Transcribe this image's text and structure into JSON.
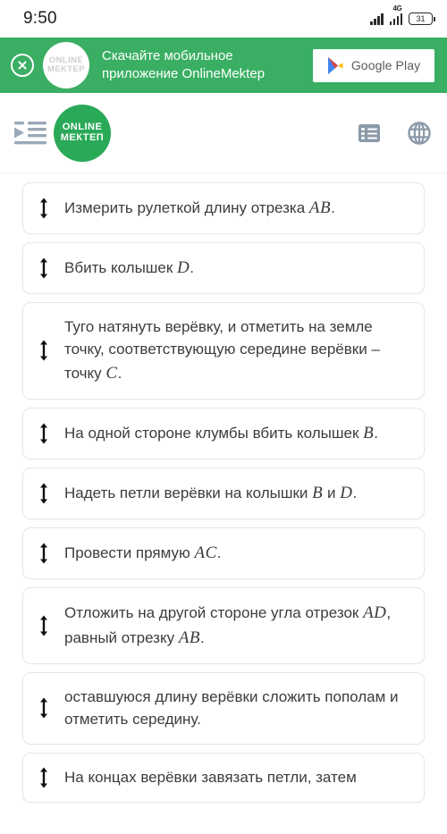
{
  "status_bar": {
    "time": "9:50",
    "network_label": "4G",
    "battery_level": "31",
    "signal_icon": "signal-bars-icon",
    "battery_icon": "battery-icon"
  },
  "promo_banner": {
    "close_icon": "close-circle-icon",
    "logo_line1": "ONLINE",
    "logo_line2": "MEKTEP",
    "text_line1": "Скачайте мобильное",
    "text_line2": "приложение OnlineMektep",
    "store_button_label": "Google Play",
    "store_icon": "google-play-icon",
    "background_color": "#3aaf63"
  },
  "app_header": {
    "menu_icon": "indent-list-icon",
    "brand_line1": "ONLINE",
    "brand_line2": "МЕКТЕП",
    "brand_color": "#2aa958",
    "list_icon": "list-view-icon",
    "language_icon": "globe-icon",
    "icon_color": "#8b9aa8"
  },
  "main": {
    "drag_handle_icon": "vertical-drag-arrow-icon",
    "items": [
      {
        "id": "item-1",
        "parts": [
          {
            "t": "Измерить рулеткой длину отрезка ",
            "math": false
          },
          {
            "t": "AB",
            "math": true
          },
          {
            "t": ".",
            "math": false
          }
        ]
      },
      {
        "id": "item-2",
        "parts": [
          {
            "t": "Вбить колышек ",
            "math": false
          },
          {
            "t": "D",
            "math": true
          },
          {
            "t": ".",
            "math": false
          }
        ]
      },
      {
        "id": "item-3",
        "parts": [
          {
            "t": "Туго натянуть верёвку, и отметить на земле точку, соответствующую середине верёвки – точку ",
            "math": false
          },
          {
            "t": "C",
            "math": true
          },
          {
            "t": ".",
            "math": false
          }
        ]
      },
      {
        "id": "item-4",
        "parts": [
          {
            "t": "На одной стороне клумбы вбить колышек ",
            "math": false
          },
          {
            "t": "B",
            "math": true
          },
          {
            "t": ".",
            "math": false
          }
        ]
      },
      {
        "id": "item-5",
        "parts": [
          {
            "t": "Надеть петли верёвки на колышки ",
            "math": false
          },
          {
            "t": "B",
            "math": true
          },
          {
            "t": " и ",
            "math": false
          },
          {
            "t": "D",
            "math": true
          },
          {
            "t": ".",
            "math": false
          }
        ]
      },
      {
        "id": "item-6",
        "parts": [
          {
            "t": "Провести прямую ",
            "math": false
          },
          {
            "t": "AC",
            "math": true
          },
          {
            "t": ".",
            "math": false
          }
        ]
      },
      {
        "id": "item-7",
        "parts": [
          {
            "t": "Отложить на другой стороне угла отрезок ",
            "math": false
          },
          {
            "t": "AD",
            "math": true
          },
          {
            "t": ", равный отрезку ",
            "math": false
          },
          {
            "t": "AB",
            "math": true
          },
          {
            "t": ".",
            "math": false
          }
        ]
      },
      {
        "id": "item-8",
        "parts": [
          {
            "t": "оставшуюся длину верёвки сложить пополам и отметить середину.",
            "math": false
          }
        ]
      },
      {
        "id": "item-9",
        "parts": [
          {
            "t": "На концах верёвки завязать петли, затем",
            "math": false
          }
        ]
      }
    ]
  }
}
